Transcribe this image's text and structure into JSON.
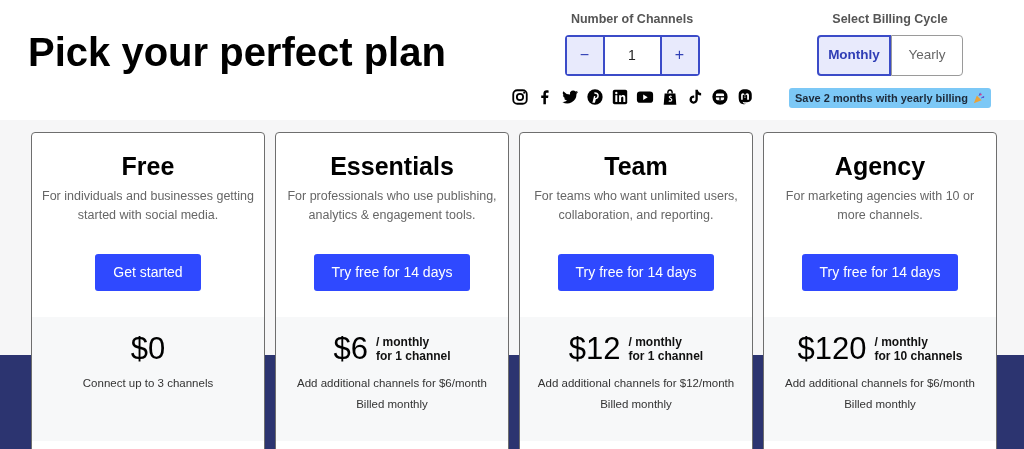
{
  "title": "Pick your perfect plan",
  "channels": {
    "label": "Number of Channels",
    "decrement": "−",
    "value": "1",
    "increment": "+"
  },
  "billing": {
    "label": "Select Billing Cycle",
    "options": [
      {
        "label": "Monthly",
        "selected": true
      },
      {
        "label": "Yearly",
        "selected": false
      }
    ],
    "promo": "Save 2 months with yearly billing"
  },
  "plans": [
    {
      "name": "Free",
      "description": "For individuals and businesses getting started with social media.",
      "button": "Get started",
      "price": "$0",
      "notes": [
        "Connect up to 3 channels"
      ]
    },
    {
      "name": "Essentials",
      "description": "For professionals who use publishing, analytics & engagement tools.",
      "button": "Try free for 14 days",
      "price": "$6",
      "period": "/ monthly",
      "per": "for 1 channel",
      "notes": [
        "Add additional channels for $6/month",
        "Billed monthly"
      ]
    },
    {
      "name": "Team",
      "description": "For teams who want unlimited users, collaboration, and reporting.",
      "button": "Try free for 14 days",
      "price": "$12",
      "period": "/ monthly",
      "per": "for 1 channel",
      "notes": [
        "Add additional channels for $12/month",
        "Billed monthly"
      ]
    },
    {
      "name": "Agency",
      "description": "For marketing agencies with 10 or more channels.",
      "button": "Try free for 14 days",
      "price": "$120",
      "period": "/ monthly",
      "per": "for 10 channels",
      "notes": [
        "Add additional channels for $6/month",
        "Billed monthly"
      ]
    }
  ]
}
